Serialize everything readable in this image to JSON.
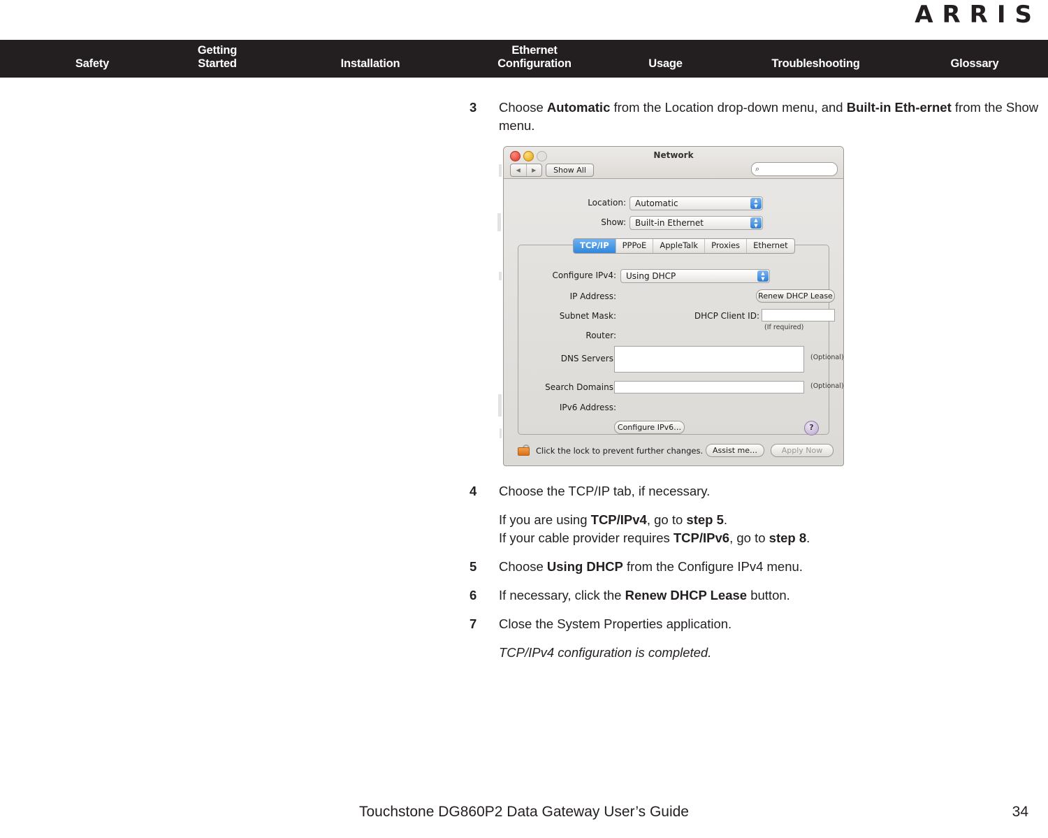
{
  "brand": {
    "logo_text": "ARRIS"
  },
  "navbar": {
    "items": [
      {
        "label": "Safety"
      },
      {
        "label": "Getting\nStarted"
      },
      {
        "label": "Installation"
      },
      {
        "label": "Ethernet\nConfiguration"
      },
      {
        "label": "Usage"
      },
      {
        "label": "Troubleshooting"
      },
      {
        "label": "Glossary"
      }
    ],
    "background_color": "#231f20",
    "text_color": "#ffffff"
  },
  "content": {
    "steps": [
      {
        "number": "3",
        "html": "Choose <b>Automatic</b> from the Location drop-down menu, and <b>Built-in Eth-ernet</b> from the Show menu."
      },
      {
        "number": "4",
        "html": "Choose the TCP/IP tab, if necessary."
      },
      {
        "number": "5",
        "html": "Choose <b>Using DHCP</b> from the Configure IPv4 menu."
      },
      {
        "number": "6",
        "html": "If necessary, click the <b>Renew DHCP Lease</b> button."
      },
      {
        "number": "7",
        "html": "Close the System Properties application."
      }
    ],
    "note_after_step4": "If you are using <b>TCP/IPv4</b>, go to <b>step 5</b>.<br>If your cable provider requires <b>TCP/IPv6</b>, go to <b>step 8</b>.",
    "note_after_step7": "TCP/IPv4 configuration is completed."
  },
  "screenshot": {
    "window_title": "Network",
    "toolbar": {
      "back_arrow": "◀",
      "forward_arrow": "▶",
      "show_all_label": "Show All",
      "search_placeholder": "",
      "search_icon": "⌕"
    },
    "location": {
      "label": "Location:",
      "value": "Automatic"
    },
    "show": {
      "label": "Show:",
      "value": "Built-in Ethernet"
    },
    "tabs": [
      {
        "label": "TCP/IP",
        "active": true
      },
      {
        "label": "PPPoE",
        "active": false
      },
      {
        "label": "AppleTalk",
        "active": false
      },
      {
        "label": "Proxies",
        "active": false
      },
      {
        "label": "Ethernet",
        "active": false
      }
    ],
    "tcpip": {
      "configure_ipv4_label": "Configure IPv4:",
      "configure_ipv4_value": "Using DHCP",
      "ip_address_label": "IP Address:",
      "ip_address_value": "",
      "renew_lease_button": "Renew DHCP Lease",
      "subnet_mask_label": "Subnet Mask:",
      "subnet_mask_value": "",
      "dhcp_client_id_label": "DHCP Client ID:",
      "dhcp_client_id_value": "",
      "dhcp_client_id_hint": "(If required)",
      "router_label": "Router:",
      "router_value": "",
      "dns_servers_label": "DNS Servers:",
      "dns_servers_value": "",
      "dns_optional_hint": "(Optional)",
      "search_domains_label": "Search Domains:",
      "search_domains_value": "",
      "search_domains_optional_hint": "(Optional)",
      "ipv6_address_label": "IPv6 Address:",
      "ipv6_address_value": "",
      "configure_ipv6_button": "Configure IPv6…",
      "help_button": "?"
    },
    "footer": {
      "lock_text": "Click the lock to prevent further changes.",
      "assist_button": "Assist me…",
      "apply_button": "Apply Now"
    }
  },
  "page_footer": {
    "title": "Touchstone DG860P2 Data Gateway User’s Guide",
    "page_number": "34"
  }
}
